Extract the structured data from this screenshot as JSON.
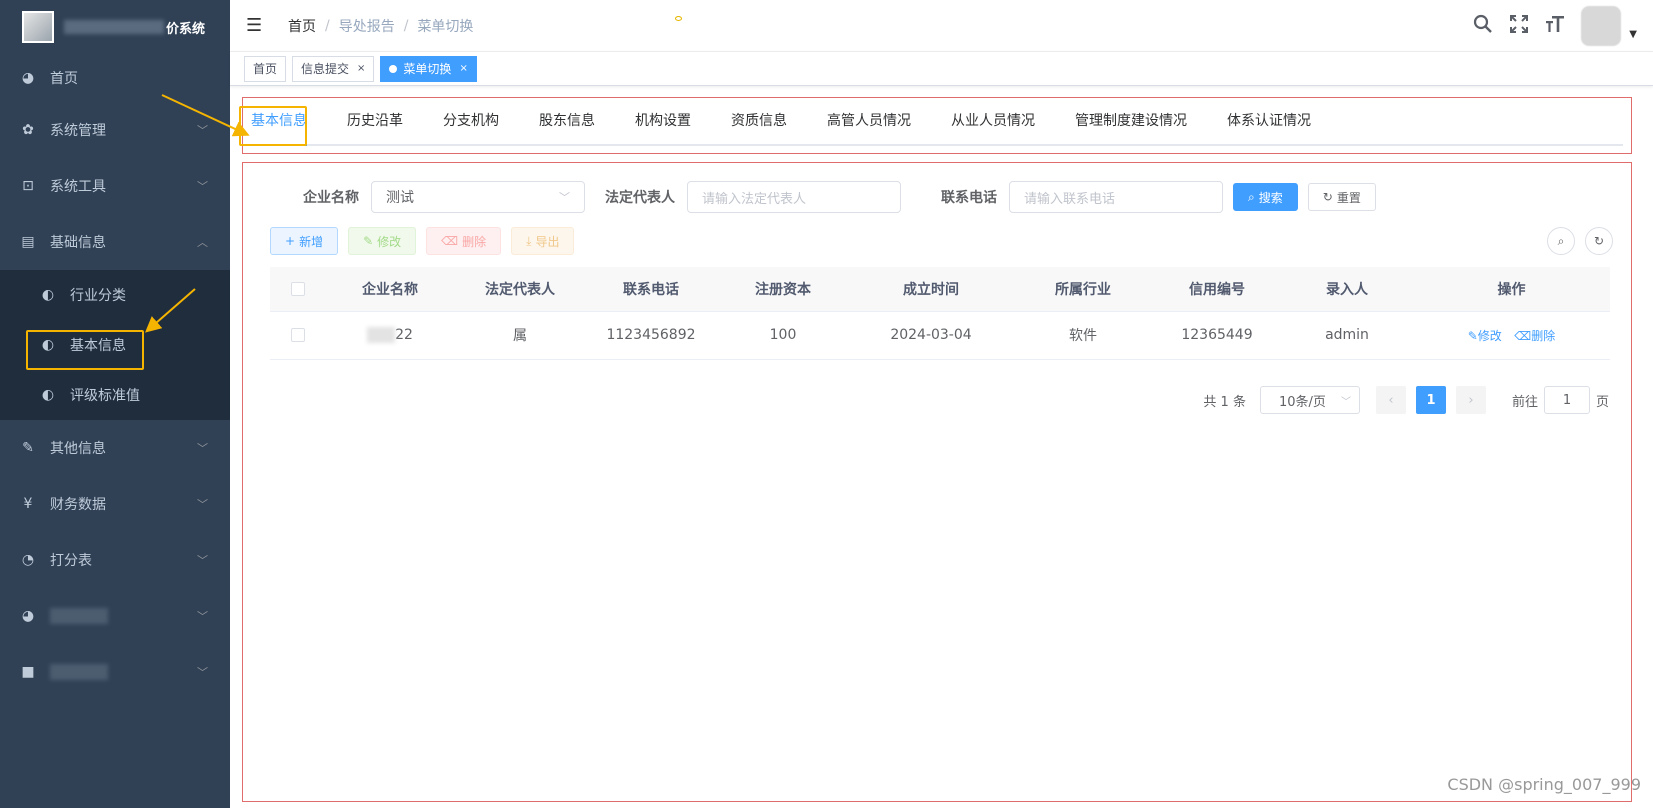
{
  "app": {
    "title": "价系统"
  },
  "sidebar": {
    "items": [
      {
        "label": "首页",
        "icon": "dashboard-icon",
        "glyph": "◕"
      },
      {
        "label": "系统管理",
        "icon": "gear-icon",
        "glyph": "✿",
        "chevron": "﹀"
      },
      {
        "label": "系统工具",
        "icon": "toolbox-icon",
        "glyph": "⊡",
        "chevron": "﹀"
      },
      {
        "label": "基础信息",
        "icon": "table-icon",
        "glyph": "▤",
        "chevron": "︿"
      },
      {
        "label": "其他信息",
        "icon": "edit-icon",
        "glyph": "✎",
        "chevron": "﹀"
      },
      {
        "label": "财务数据",
        "icon": "yen-icon",
        "glyph": "¥",
        "chevron": "﹀"
      },
      {
        "label": "打分表",
        "icon": "clock-icon",
        "glyph": "◔",
        "chevron": "﹀"
      }
    ],
    "submenu": [
      {
        "label": "行业分类",
        "glyph": "◐"
      },
      {
        "label": "基本信息",
        "glyph": "◐"
      },
      {
        "label": "评级标准值",
        "glyph": "◐"
      }
    ]
  },
  "navbar": {
    "breadcrumb": [
      "首页",
      "导处报告",
      "菜单切换"
    ],
    "sep": "/"
  },
  "tags": [
    {
      "label": "首页"
    },
    {
      "label": "信息提交",
      "close": "×"
    },
    {
      "label": "菜单切换",
      "close": "×"
    }
  ],
  "tabs": [
    "基本信息",
    "历史沿革",
    "分支机构",
    "股东信息",
    "机构设置",
    "资质信息",
    "高管人员情况",
    "从业人员情况",
    "管理制度建设情况",
    "体系认证情况"
  ],
  "search": {
    "company_label": "企业名称",
    "company_value": "测试",
    "legal_label": "法定代表人",
    "legal_placeholder": "请输入法定代表人",
    "phone_label": "联系电话",
    "phone_placeholder": "请输入联系电话",
    "search_btn": "搜索",
    "reset_btn": "重置"
  },
  "toolbar": {
    "add": "新增",
    "edit": "修改",
    "delete": "删除",
    "export": "导出"
  },
  "table": {
    "headers": [
      "企业名称",
      "法定代表人",
      "联系电话",
      "注册资本",
      "成立时间",
      "所属行业",
      "信用编号",
      "录入人",
      "操作"
    ],
    "rows": [
      {
        "name_suffix": "22",
        "legal": "属",
        "phone": "1123456892",
        "capital": "100",
        "date": "2024-03-04",
        "industry": "软件",
        "credit": "12365449",
        "creator": "admin",
        "edit": "修改",
        "delete": "删除"
      }
    ]
  },
  "pagination": {
    "total": "共 1 条",
    "size": "10条/页",
    "page": "1",
    "goto": "前往",
    "goto_value": "1",
    "unit": "页"
  },
  "watermark": "CSDN @spring_007_999",
  "colors": {
    "sidebar": "#304156",
    "accent": "#409eff",
    "highlight": "#f5b400",
    "frame": "#e06c6c"
  }
}
